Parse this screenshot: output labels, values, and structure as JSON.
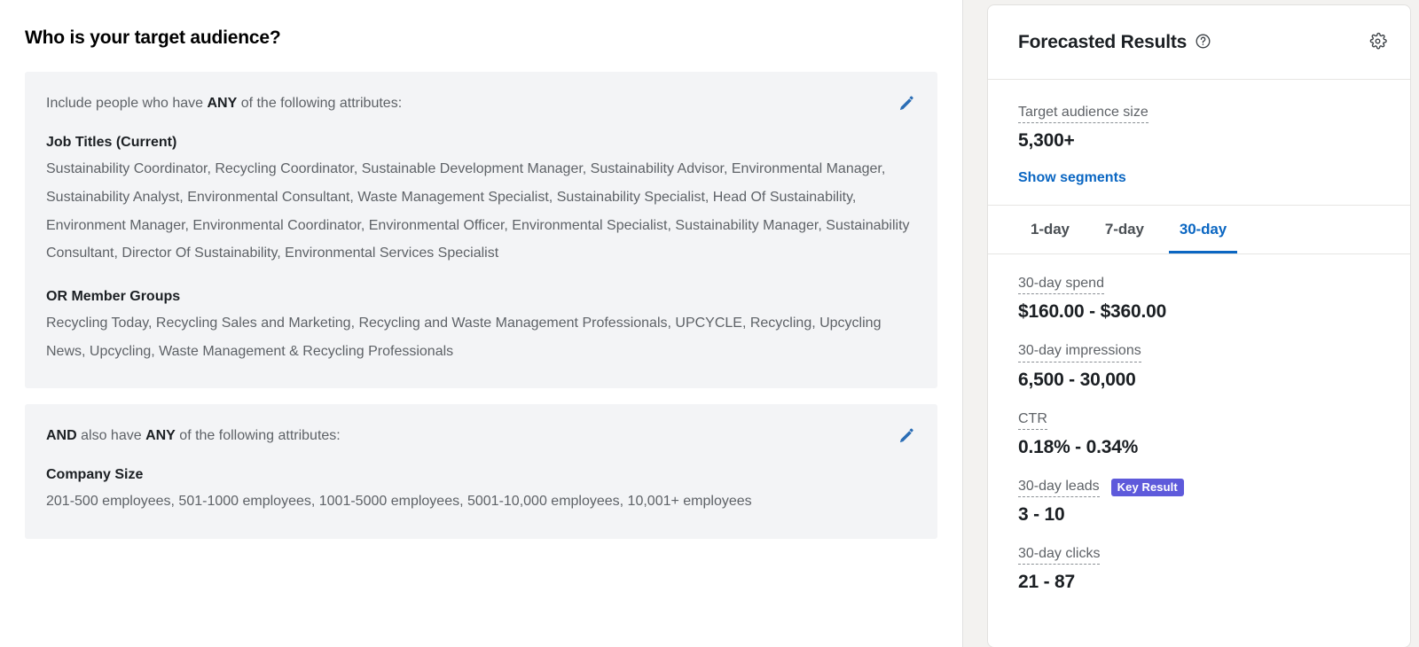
{
  "left": {
    "page_title": "Who is your target audience?",
    "facets": [
      {
        "intro_prefix": "Include people who have ",
        "intro_emphasis": "ANY",
        "intro_suffix": " of the following attributes:",
        "edit_icon": "pencil-edit-icon",
        "groups": [
          {
            "title": "Job Titles (Current)",
            "values": "Sustainability Coordinator, Recycling Coordinator, Sustainable Development Manager, Sustainability Advisor, Environmental Manager, Sustainability Analyst, Environmental Consultant, Waste Management Specialist, Sustainability Specialist, Head Of Sustainability, Environment Manager, Environmental Coordinator, Environmental Officer, Environmental Specialist, Sustainability Manager, Sustainability Consultant, Director Of Sustainability, Environmental Services Specialist"
          },
          {
            "title": "OR Member Groups",
            "values": "Recycling Today, Recycling Sales and Marketing, Recycling and Waste Management Professionals, UPCYCLE, Recycling, Upcycling News, Upcycling, Waste Management & Recycling Professionals"
          }
        ]
      },
      {
        "intro_prefix": "",
        "intro_emphasis": "AND",
        "intro_middle": " also have ",
        "intro_emphasis2": "ANY",
        "intro_suffix": " of the following attributes:",
        "edit_icon": "pencil-edit-icon",
        "groups": [
          {
            "title": "Company Size",
            "values": "201-500 employees, 501-1000 employees, 1001-5000 employees, 5001-10,000 employees, 10,001+ employees"
          }
        ]
      }
    ]
  },
  "right": {
    "title": "Forecasted Results",
    "help_icon": "help-circle-icon",
    "settings_icon": "gear-icon",
    "audience": {
      "label": "Target audience size",
      "value": "5,300+",
      "show_segments_label": "Show segments"
    },
    "tabs": [
      {
        "label": "1-day",
        "active": false
      },
      {
        "label": "7-day",
        "active": false
      },
      {
        "label": "30-day",
        "active": true
      }
    ],
    "metrics": [
      {
        "label": "30-day spend",
        "value": "$160.00 - $360.00"
      },
      {
        "label": "30-day impressions",
        "value": "6,500 - 30,000"
      },
      {
        "label": "CTR",
        "value": "0.18% - 0.34%"
      },
      {
        "label": "30-day leads",
        "value": "3 - 10",
        "badge": "Key Result"
      },
      {
        "label": "30-day clicks",
        "value": "21 - 87"
      }
    ]
  },
  "colors": {
    "link_blue": "#0a66c2",
    "badge_purple": "#5e5adb",
    "panel_gray": "#f3f4f6"
  }
}
